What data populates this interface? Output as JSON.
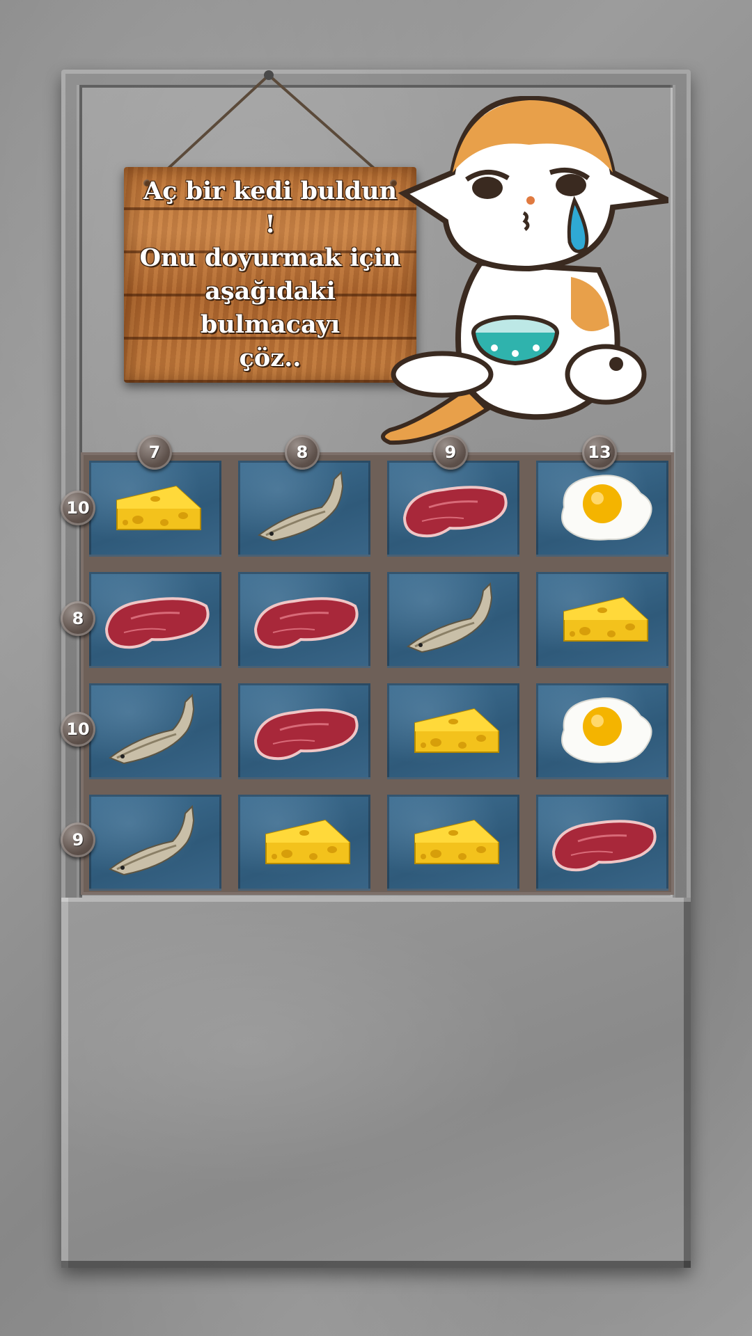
{
  "sign": {
    "line1": "Aç bir kedi buldun !",
    "line2": "Onu doyurmak için",
    "line3": "aşağıdaki bulmacayı",
    "line4": "çöz.."
  },
  "column_clues": [
    "7",
    "8",
    "9",
    "13"
  ],
  "row_clues": [
    "10",
    "8",
    "10",
    "9"
  ],
  "grid": [
    [
      "cheese-icon",
      "fish-icon",
      "meat-icon",
      "egg-icon"
    ],
    [
      "meat-icon",
      "meat-icon",
      "fish-icon",
      "cheese-icon"
    ],
    [
      "fish-icon",
      "meat-icon",
      "cheese-icon",
      "egg-icon"
    ],
    [
      "fish-icon",
      "cheese-icon",
      "cheese-icon",
      "meat-icon"
    ]
  ],
  "colors": {
    "cell_blue": "#2f5a7a",
    "wood": "#b86f33",
    "cat_orange": "#e8a04a"
  }
}
